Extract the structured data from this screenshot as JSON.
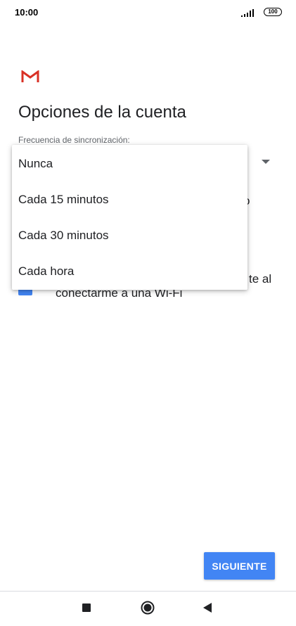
{
  "status_bar": {
    "time": "10:00",
    "battery": "100"
  },
  "screen": {
    "title": "Opciones de la cuenta",
    "sync_label": "Frecuencia de sincronización:",
    "behind_fragments": [
      "o",
      "te al",
      "conectarme a una Wi-Fi"
    ]
  },
  "dropdown": {
    "options": [
      "Nunca",
      "Cada 15 minutos",
      "Cada 30 minutos",
      "Cada hora"
    ]
  },
  "footer": {
    "next_label": "SIGUIENTE"
  },
  "colors": {
    "accent": "#4285f4",
    "gmail_red": "#d93025"
  }
}
